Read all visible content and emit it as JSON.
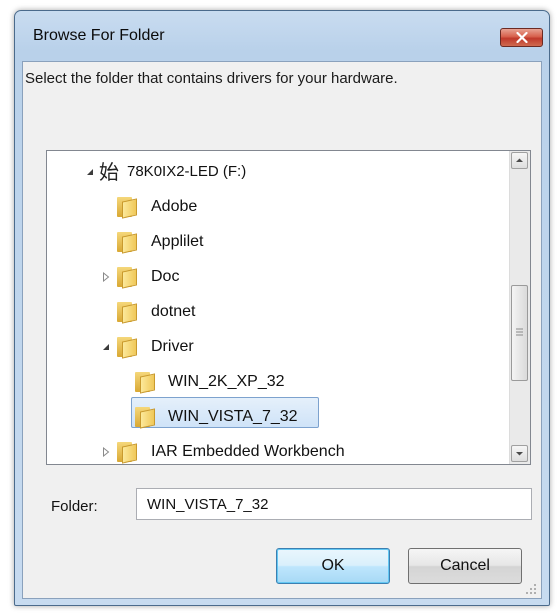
{
  "dialog": {
    "title": "Browse For Folder",
    "instruction": "Select the folder that contains drivers for your hardware."
  },
  "tree": {
    "items": [
      {
        "label": "78K0IX2-LED (F:)",
        "icon": "drive-icon",
        "expander": "expanded"
      },
      {
        "label": "Adobe",
        "icon": "folder-icon",
        "expander": "none"
      },
      {
        "label": "Applilet",
        "icon": "folder-icon",
        "expander": "none"
      },
      {
        "label": "Doc",
        "icon": "folder-icon",
        "expander": "collapsed"
      },
      {
        "label": "dotnet",
        "icon": "folder-icon",
        "expander": "none"
      },
      {
        "label": "Driver",
        "icon": "folder-icon",
        "expander": "expanded"
      },
      {
        "label": "WIN_2K_XP_32",
        "icon": "folder-icon",
        "expander": "none"
      },
      {
        "label": "WIN_VISTA_7_32",
        "icon": "folder-icon",
        "expander": "none",
        "selected": true
      },
      {
        "label": "IAR Embedded Workbench",
        "icon": "folder-icon",
        "expander": "collapsed"
      }
    ],
    "drive_glyph": "始"
  },
  "folder_field": {
    "label": "Folder:",
    "value": "WIN_VISTA_7_32"
  },
  "buttons": {
    "ok": "OK",
    "cancel": "Cancel"
  },
  "colors": {
    "selection": "#cfe3f8",
    "close_button": "#c0392b"
  }
}
